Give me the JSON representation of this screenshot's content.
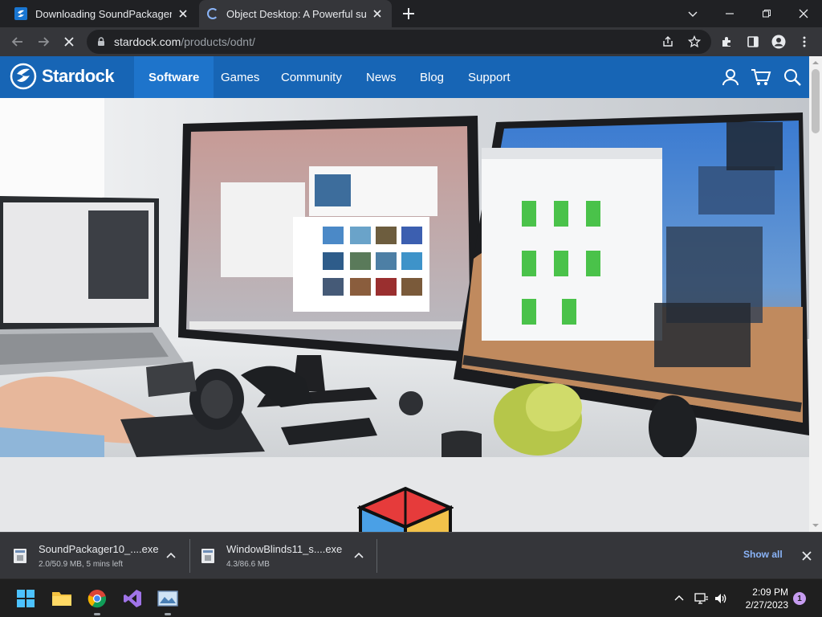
{
  "browser": {
    "tabs": [
      {
        "title": "Downloading SoundPackager : St",
        "active": false
      },
      {
        "title": "Object Desktop: A Powerful suite",
        "active": true
      }
    ],
    "url_host": "stardock.com",
    "url_path": "/products/odnt/"
  },
  "site": {
    "logo_text": "Stardock",
    "nav": [
      "Software",
      "Games",
      "Community",
      "News",
      "Blog",
      "Support"
    ],
    "active_nav": "Software",
    "colors": {
      "nav_bg": "#1765b5",
      "nav_active": "#1e74cb"
    }
  },
  "downloads": {
    "items": [
      {
        "filename": "SoundPackager10_....exe",
        "status": "2.0/50.9 MB, 5 mins left"
      },
      {
        "filename": "WindowBlinds11_s....exe",
        "status": "4.3/86.6 MB"
      }
    ],
    "show_all": "Show all"
  },
  "taskbar": {
    "apps": [
      "start-icon",
      "file-explorer-icon",
      "chrome-icon",
      "visual-studio-icon",
      "image-viewer-icon"
    ],
    "time": "2:09 PM",
    "date": "2/27/2023",
    "notification_count": "1"
  }
}
